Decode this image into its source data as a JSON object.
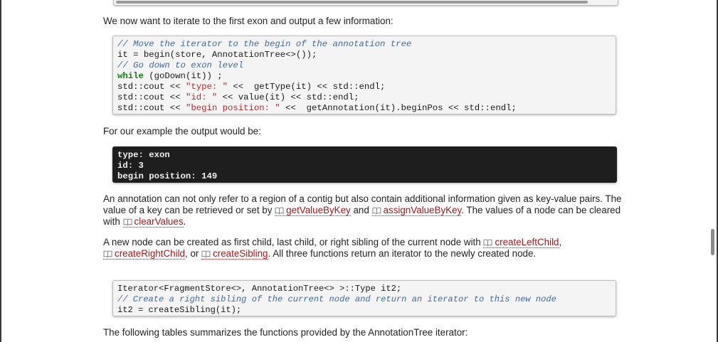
{
  "colors": {
    "link": "#a0181a",
    "comment": "#3e6aa3",
    "keyword": "#118011",
    "string": "#c0282a",
    "output_background": "#1e1e1e",
    "code_background": "#f4f4f4"
  },
  "intro_text": "We now want to iterate to the first exon and output a few information:",
  "code_block_1": {
    "comment_1": "// Move the iterator to the begin of the annotation tree",
    "line_2": "it = begin(store, AnnotationTree<>());",
    "comment_3": "// Go down to exon level",
    "keyword_while": "while",
    "line_4_rest": " (goDown(it)) ;",
    "cout_prefix": "std::cout << ",
    "str_type": "\"type: \"",
    "line_5_rest": " <<  getType(it) << std::endl;",
    "str_id": "\"id: \"",
    "line_6_rest": " << value(it) << std::endl;",
    "str_begin": "\"begin position: \"",
    "line_7_rest": " <<  getAnnotation(it).beginPos << std::endl;"
  },
  "output_intro": "For our example the output would be:",
  "output_block": {
    "line_1": "type: exon",
    "line_2": "id: 3",
    "line_3": "begin position: 149"
  },
  "para_annotation": {
    "text_1": "An annotation can not only refer to a region of a contig but also contain additional information given as key-value pairs. The value of a key can be retrieved or set by ",
    "link_get": "getValueByKey",
    "text_2": " and ",
    "link_assign": "assignValueByKey",
    "text_3": ". The values of a node can be cleared with ",
    "link_clear": "clearValues",
    "text_4": "."
  },
  "para_nodes": {
    "text_1": "A new node can be created as first child, last child, or right sibling of the current node with ",
    "link_left": "createLeftChild",
    "sep_1": ", ",
    "link_right": "createRightChild",
    "sep_2": ", or ",
    "link_sibling": "createSibling",
    "text_2": ". All three functions return an iterator to the newly created node."
  },
  "code_block_2": {
    "line_1": "Iterator<FragmentStore<>, AnnotationTree<> >::Type it2;",
    "comment_2": "// Create a right sibling of the current node and return an iterator to this new node",
    "line_3": "it2 = createSibling(it);"
  },
  "tables_intro": "The following tables summarizes the functions provided by the AnnotationTree iterator:",
  "icons": {
    "api_link_icon": "book-icon"
  }
}
